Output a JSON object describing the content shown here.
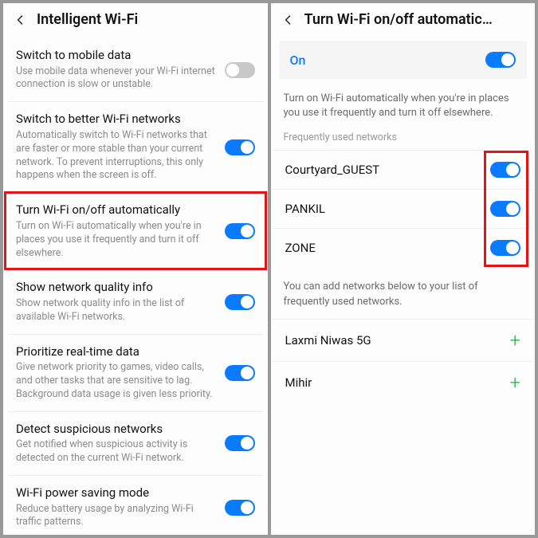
{
  "left": {
    "title": "Intelligent Wi-Fi",
    "items": [
      {
        "title": "Switch to mobile data",
        "desc": "Use mobile data whenever your Wi-Fi internet connection is slow or unstable.",
        "toggle": "off"
      },
      {
        "title": "Switch to better Wi-Fi networks",
        "desc": "Automatically switch to Wi-Fi networks that are faster or more stable than your current network. To prevent interruptions, this only happens when the screen is off.",
        "toggle": "on"
      },
      {
        "title": "Turn Wi-Fi on/off automatically",
        "desc": "Turn on Wi-Fi automatically when you're in places you use it frequently and turn it off elsewhere.",
        "toggle": "on",
        "highlight": true
      },
      {
        "title": "Show network quality info",
        "desc": "Show network quality info in the list of available Wi-Fi networks.",
        "toggle": "on"
      },
      {
        "title": "Prioritize real-time data",
        "desc": "Give network priority to games, video calls, and other tasks that are sensitive to lag. Background data usage is given less priority.",
        "toggle": "on"
      },
      {
        "title": "Detect suspicious networks",
        "desc": "Get notified when suspicious activity is detected on the current Wi-Fi network.",
        "toggle": "on"
      },
      {
        "title": "Wi-Fi power saving mode",
        "desc": "Reduce battery usage by analyzing Wi-Fi traffic patterns.",
        "toggle": "on"
      }
    ]
  },
  "right": {
    "title": "Turn Wi-Fi on/off automatic…",
    "master": {
      "label": "On",
      "toggle": "on"
    },
    "info": "Turn on Wi-Fi automatically when you're in places you use it frequently and turn it off elsewhere.",
    "freq_label": "Frequently used networks",
    "networks": [
      {
        "name": "Courtyard_GUEST",
        "toggle": "on"
      },
      {
        "name": "PANKIL",
        "toggle": "on"
      },
      {
        "name": "ZONE",
        "toggle": "on"
      }
    ],
    "add_info": "You can add networks below to your list of frequently used networks.",
    "addable": [
      {
        "name": "Laxmi Niwas 5G"
      },
      {
        "name": "Mihir"
      }
    ]
  }
}
